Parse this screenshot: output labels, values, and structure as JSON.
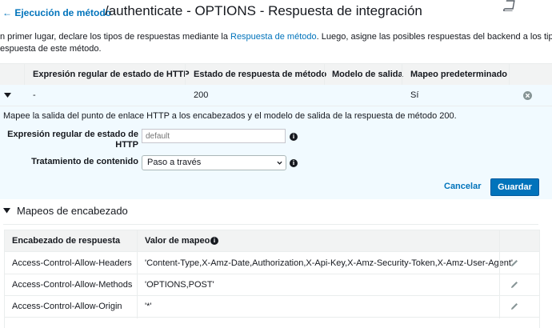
{
  "header": {
    "back_link": "← Ejecución de método",
    "title": "/authenticate - OPTIONS - Respuesta de integración"
  },
  "intro": {
    "line1_before": "n primer lugar, declare los tipos de respuestas mediante la ",
    "line1_link": "Respuesta de método",
    "line1_after": ". Luego, asigne las posibles respuestas del backend a los tipos de",
    "line2": "espuesta de este método."
  },
  "responses_table": {
    "columns": [
      "Expresión regular de estado de HTTP",
      "Estado de respuesta de método",
      "Modelo de salida",
      "Mapeo predeterminado"
    ],
    "row": {
      "regex": "-",
      "status": "200",
      "model": "",
      "default_mapping": "Sí"
    }
  },
  "detail": {
    "description": "Mapee la salida del punto de enlace HTTP a los encabezados y el modelo de salida de la respuesta de método 200.",
    "regex_label_1": "Expresión regular de estado de",
    "regex_label_2": "HTTP",
    "regex_placeholder": "default",
    "content_label": "Tratamiento de contenido",
    "content_value": "Paso a través",
    "cancel": "Cancelar",
    "save": "Guardar"
  },
  "header_mappings": {
    "title": "Mapeos de encabezado",
    "col_header": "Encabezado de respuesta",
    "col_value": "Valor de mapeo",
    "rows": [
      {
        "header": "Access-Control-Allow-Headers",
        "value": "'Content-Type,X-Amz-Date,Authorization,X-Api-Key,X-Amz-Security-Token,X-Amz-User-Agent'"
      },
      {
        "header": "Access-Control-Allow-Methods",
        "value": "'OPTIONS,POST'"
      },
      {
        "header": "Access-Control-Allow-Origin",
        "value": "'*'"
      }
    ]
  },
  "icons": {
    "book": "book-icon",
    "remove": "remove-circle-icon",
    "info": "info-icon",
    "edit": "pencil-icon",
    "toggle": "caret-down-icon"
  },
  "colors": {
    "link": "#0073bb",
    "primary_button": "#0073bb",
    "selected_row_bg": "#f1faff",
    "table_header_bg": "#f2f3f3"
  }
}
